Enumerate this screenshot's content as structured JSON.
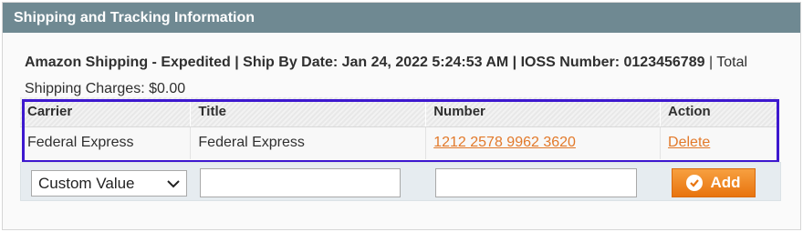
{
  "panel": {
    "title": "Shipping and Tracking Information"
  },
  "summary": {
    "bold_line": "Amazon Shipping - Expedited | Ship By Date: Jan 24, 2022 5:24:53 AM | IOSS Number: 0123456789",
    "separator": " | ",
    "charges": "Total Shipping Charges: $0.00"
  },
  "tracking_table": {
    "headers": [
      "Carrier",
      "Title",
      "Number",
      "Action"
    ],
    "rows": [
      {
        "carrier": "Federal Express",
        "title": "Federal Express",
        "number": "1212 2578 9962 3620",
        "action": "Delete"
      }
    ]
  },
  "add_row": {
    "carrier_select_value": "Custom Value",
    "add_label": "Add"
  },
  "colors": {
    "header_bg": "#6f8992",
    "link": "#e2792a",
    "highlight_border": "#3d18cf",
    "add_button": "#f08a24"
  }
}
